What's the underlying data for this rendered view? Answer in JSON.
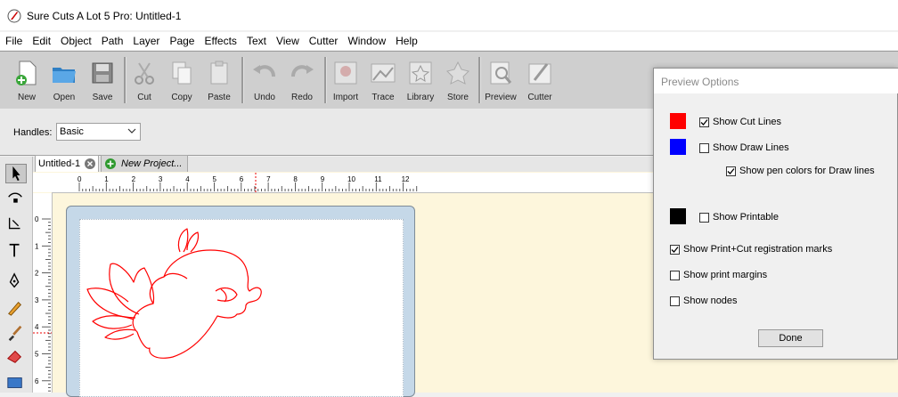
{
  "window": {
    "title": "Sure Cuts A Lot 5 Pro: Untitled-1",
    "icon": "scal-app-icon"
  },
  "menu": [
    "File",
    "Edit",
    "Object",
    "Path",
    "Layer",
    "Page",
    "Effects",
    "Text",
    "View",
    "Cutter",
    "Window",
    "Help"
  ],
  "toolbar": {
    "items": [
      {
        "label": "New",
        "icon": "new-file-icon"
      },
      {
        "label": "Open",
        "icon": "open-folder-icon"
      },
      {
        "label": "Save",
        "icon": "save-disk-icon"
      },
      {
        "label": "Cut",
        "icon": "scissors-icon"
      },
      {
        "label": "Copy",
        "icon": "copy-icon"
      },
      {
        "label": "Paste",
        "icon": "paste-icon"
      },
      {
        "label": "Undo",
        "icon": "undo-icon"
      },
      {
        "label": "Redo",
        "icon": "redo-icon"
      },
      {
        "label": "Import",
        "icon": "import-icon"
      },
      {
        "label": "Trace",
        "icon": "trace-icon"
      },
      {
        "label": "Library",
        "icon": "library-icon"
      },
      {
        "label": "Store",
        "icon": "store-icon"
      },
      {
        "label": "Preview",
        "icon": "preview-icon"
      },
      {
        "label": "Cutter",
        "icon": "cutter-icon"
      }
    ]
  },
  "options": {
    "handles_label": "Handles:",
    "handles_value": "Basic"
  },
  "tools": [
    "select-arrow-icon",
    "node-edit-icon",
    "crop-icon",
    "text-tool-icon",
    "pen-tool-icon",
    "pencil-icon",
    "brush-icon",
    "eraser-icon",
    "rectangle-icon"
  ],
  "tabs": [
    {
      "label": "Untitled-1",
      "active": true
    },
    {
      "label": "New Project..."
    }
  ],
  "ruler": {
    "h_labels": [
      "0",
      "1",
      "2",
      "3",
      "4",
      "5",
      "6",
      "7",
      "8",
      "9",
      "10",
      "11",
      "12"
    ],
    "v_labels": [
      "0",
      "1",
      "2",
      "3",
      "4",
      "5",
      "6"
    ]
  },
  "preview_dialog": {
    "title": "Preview Options",
    "options": [
      {
        "label": "Show Cut Lines",
        "checked": true,
        "swatch": "#ff0000"
      },
      {
        "label": "Show Draw Lines",
        "checked": false,
        "swatch": "#0000ff"
      },
      {
        "label": "Show pen colors for Draw lines",
        "checked": true
      },
      {
        "label": "Show Printable",
        "checked": false,
        "swatch": "#000000"
      },
      {
        "label": "Show Print+Cut registration marks",
        "checked": true
      },
      {
        "label": "Show print margins",
        "checked": false
      },
      {
        "label": "Show nodes",
        "checked": false
      }
    ],
    "done_label": "Done"
  },
  "colors": {
    "cut_line": "#ff0000",
    "canvas_bg": "#fdf6dc",
    "mat": "#c5d8e8"
  }
}
